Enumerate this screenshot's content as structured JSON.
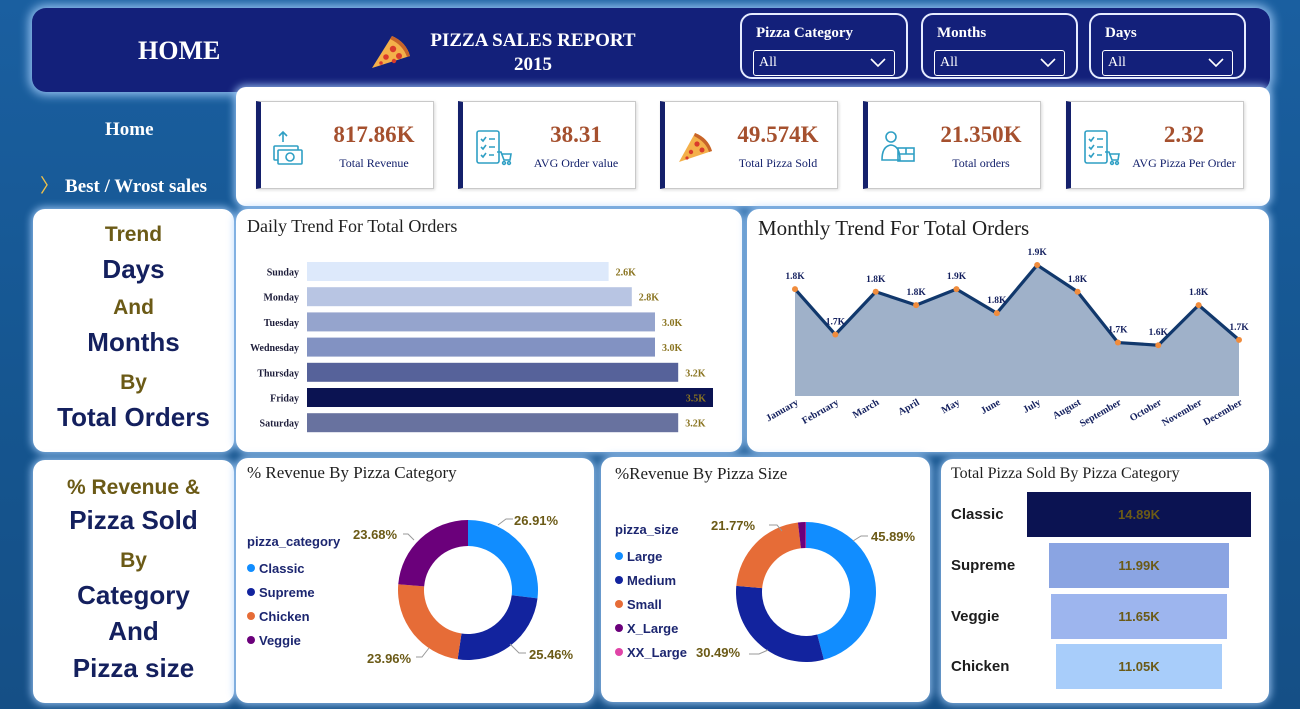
{
  "header": {
    "home_title": "HOME",
    "report_title_line1": "PIZZA SALES REPORT",
    "report_title_line2": "2015",
    "slicers": [
      {
        "label": "Pizza Category",
        "value": "All"
      },
      {
        "label": "Months",
        "value": "All"
      },
      {
        "label": "Days",
        "value": "All"
      }
    ]
  },
  "nav": {
    "home": "Home",
    "best_worst": "Best / Wrost sales"
  },
  "kpis": [
    {
      "value": "817.86K",
      "label": "Total Revenue",
      "icon": "money-icon"
    },
    {
      "value": "38.31",
      "label": "AVG Order value",
      "icon": "order-list-icon"
    },
    {
      "value": "49.574K",
      "label": "Total Pizza Sold",
      "icon": "pizza-icon"
    },
    {
      "value": "21.350K",
      "label": "Total orders",
      "icon": "delivery-icon"
    },
    {
      "value": "2.32",
      "label": "AVG Pizza Per Order",
      "icon": "checklist-icon"
    }
  ],
  "side_top": {
    "l1": "Trend",
    "l2": "Days",
    "l3": "And",
    "l4": "Months",
    "l5": "By",
    "l6": "Total Orders"
  },
  "side_bottom": {
    "l1": "% Revenue &",
    "l2": "Pizza Sold",
    "l3": "By",
    "l4": "Category",
    "l5": "And",
    "l6": "Pizza size"
  },
  "colors": {
    "header_bg": "#13207a",
    "kpi_value": "#a5502e",
    "label_gold": "#6b5a16",
    "navy": "#14205e"
  },
  "chart_data": [
    {
      "type": "bar",
      "orientation": "horizontal",
      "title": "Daily Trend For Total Orders",
      "categories": [
        "Sunday",
        "Monday",
        "Tuesday",
        "Wednesday",
        "Thursday",
        "Friday",
        "Saturday"
      ],
      "values": [
        2.6,
        2.8,
        3.0,
        3.0,
        3.2,
        3.5,
        3.2
      ],
      "labels": [
        "2.6K",
        "2.8K",
        "3.0K",
        "3.0K",
        "3.2K",
        "3.5K",
        "3.2K"
      ],
      "colors": [
        "#dde9fb",
        "#b8c5e3",
        "#95a4cd",
        "#8292c2",
        "#56629a",
        "#0b1352",
        "#68729f"
      ],
      "xlim": [
        0,
        3.5
      ]
    },
    {
      "type": "area",
      "title": "Monthly Trend For Total Orders",
      "categories": [
        "January",
        "February",
        "March",
        "April",
        "May",
        "June",
        "July",
        "August",
        "September",
        "October",
        "November",
        "December"
      ],
      "values": [
        1.85,
        1.68,
        1.84,
        1.79,
        1.85,
        1.76,
        1.94,
        1.84,
        1.65,
        1.64,
        1.79,
        1.66
      ],
      "labels": [
        "1.8K",
        "1.7K",
        "1.8K",
        "1.8K",
        "1.9K",
        "1.8K",
        "1.9K",
        "1.8K",
        "1.7K",
        "1.6K",
        "1.8K",
        "1.7K"
      ],
      "ylim": [
        1.45,
        2.0
      ]
    },
    {
      "type": "pie",
      "title": "% Revenue By Pizza Category",
      "legend_title": "pizza_category",
      "categories": [
        "Classic",
        "Supreme",
        "Chicken",
        "Veggie"
      ],
      "values": [
        26.91,
        25.46,
        23.96,
        23.68
      ],
      "labels": [
        "26.91%",
        "25.46%",
        "23.96%",
        "23.68%"
      ],
      "colors": [
        "#118dff",
        "#12239e",
        "#e66c37",
        "#6b007b"
      ]
    },
    {
      "type": "pie",
      "title": "%Revenue By Pizza Size",
      "legend_title": "pizza_size",
      "categories": [
        "Large",
        "Medium",
        "Small",
        "X_Large",
        "XX_Large"
      ],
      "values": [
        45.89,
        30.49,
        21.77,
        1.72,
        0.12
      ],
      "labels": [
        "45.89%",
        "30.49%",
        "21.77%"
      ],
      "colors": [
        "#118dff",
        "#12239e",
        "#e66c37",
        "#6b007b",
        "#e044a7"
      ]
    },
    {
      "type": "bar",
      "orientation": "funnel",
      "title": "Total Pizza Sold By Pizza Category",
      "categories": [
        "Classic",
        "Supreme",
        "Veggie",
        "Chicken"
      ],
      "values": [
        14.89,
        11.99,
        11.65,
        11.05
      ],
      "labels": [
        "14.89K",
        "11.99K",
        "11.65K",
        "11.05K"
      ],
      "colors": [
        "#0b1352",
        "#8aa4e2",
        "#9db5ee",
        "#a8cdfa"
      ]
    }
  ]
}
